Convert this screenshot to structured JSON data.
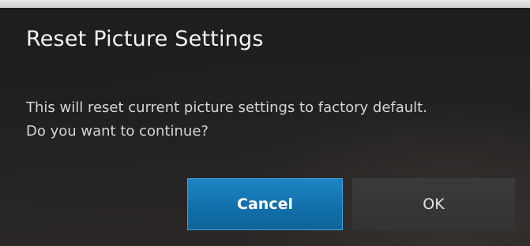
{
  "dialog": {
    "title": "Reset Picture Settings",
    "message_line_1": "This will reset current picture settings to factory default.",
    "message_line_2": "Do you want to continue?",
    "buttons": {
      "cancel_label": "Cancel",
      "ok_label": "OK"
    },
    "focused_button": "Cancel"
  },
  "colors": {
    "focus_accent": "#1270ab",
    "background": "#1f1f21",
    "text_primary": "#f4f4f4"
  }
}
